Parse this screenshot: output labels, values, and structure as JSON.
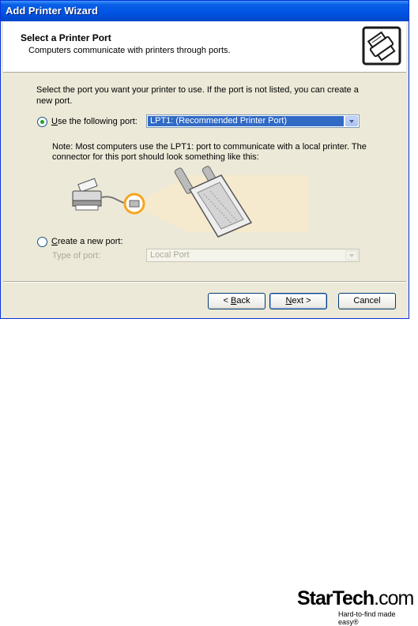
{
  "window": {
    "title": "Add Printer Wizard"
  },
  "header": {
    "title": "Select a Printer Port",
    "subtitle": "Computers communicate with printers through ports."
  },
  "intro": "Select the port you want your printer to use.  If the port is not listed, you can create a new port.",
  "use_port": {
    "label_accel": "U",
    "label_rest": "se the following port:",
    "selected": true,
    "value": "LPT1: (Recommended Printer Port)"
  },
  "note": "Note: Most computers use the LPT1: port to communicate with a local printer. The connector for this port should look something like this:",
  "new_port": {
    "label_accel": "C",
    "label_rest": "reate a new port:",
    "selected": false,
    "type_label": "Type of port:",
    "value": "Local Port"
  },
  "buttons": {
    "back_prefix": "< ",
    "back_accel": "B",
    "back_rest": "ack",
    "next_accel": "N",
    "next_rest": "ext >",
    "cancel": "Cancel"
  },
  "brand": {
    "name_part1": "StarTech",
    "name_part2": ".com",
    "tagline": "Hard-to-find made easy®"
  },
  "colors": {
    "titlebar": "#0055e5",
    "dialog_bg": "#ece9d8",
    "selection": "#316ac5",
    "radio_dot": "#21a121",
    "highlight_ring": "#f6a623"
  }
}
